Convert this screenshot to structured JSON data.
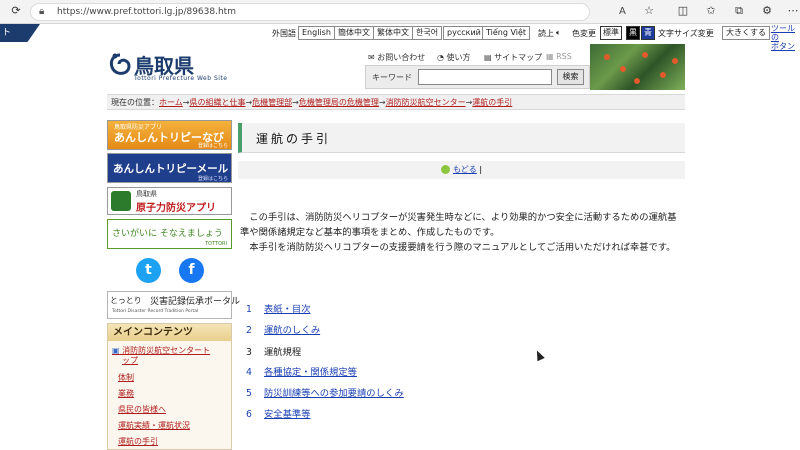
{
  "browser": {
    "url": "https://www.pref.tottori.lg.jp/89638.htm",
    "read_aloud_icon": "A",
    "favorite_icon": "☆",
    "toolbar_icons": [
      "split-screen-icon",
      "favorites-icon",
      "collections-icon",
      "extensions-icon",
      "more-icon"
    ]
  },
  "topbar": {
    "corner_tab": "ト",
    "language_label": "外国語",
    "languages": [
      "English",
      "簡体中文",
      "繁体中文",
      "한국어",
      "русский",
      "Tiếng Việt"
    ],
    "tail_text": "読上",
    "color_label": "色変更",
    "color_options": [
      "標準",
      "黒",
      "青"
    ],
    "font_size_label": "文字サイズ変更",
    "font_size_button": "大きくする",
    "tool_link_line1": "ツールの",
    "tool_link_line2": "ボタン"
  },
  "header": {
    "logo_title": "鳥取県",
    "logo_subtitle": "Tottori Prefecture Web Site",
    "util_links": [
      "お問い合わせ",
      "使い方",
      "サイトマップ",
      "RSS"
    ],
    "search_label": "キーワード",
    "search_value": "",
    "search_button": "検索"
  },
  "breadcrumb": {
    "current_label": "現在の位置：",
    "items": [
      "ホーム",
      "県の組織と仕事",
      "危機管理部",
      "危機管理局の危機管理",
      "消防防災航空センター",
      "運航の手引"
    ]
  },
  "sidebar": {
    "banners": {
      "app": {
        "top": "鳥取県防災アプリ",
        "main": "あんしんトリピーなび",
        "small": "登録はこちら"
      },
      "mail": {
        "main": "あんしんトリピーメール",
        "small": "登録はこちら"
      },
      "nuclear": {
        "top": "鳥取県",
        "main": "原子力防災アプリ"
      },
      "prepare": {
        "main": "さいがいに そなえましょう",
        "small": "TOTTORI"
      }
    },
    "social": {
      "twitter": "t",
      "facebook": "f"
    },
    "portal": {
      "left": "とっとり",
      "right": "災害記録伝承ポータル",
      "sub": "Tottori Disaster Record Tradition Portal"
    },
    "menu_title": "メインコンテンツ",
    "menu_top_line1": "消防防災航空センタート",
    "menu_top_line2": "ップ",
    "menu_items": [
      "体制",
      "業務",
      "県民の皆様へ",
      "運航実績・運航状況",
      "運航の手引"
    ]
  },
  "main": {
    "title": "運航の手引",
    "back_link": "もどる",
    "intro_line1": "この手引は、消防防災ヘリコプターが災害発生時などに、より効果的かつ安全に活動するための運航基準や関係諸規定など基本的事項をまとめ、作成したものです。",
    "intro_line2": "本手引を消防防災ヘリコプターの支援要請を行う際のマニュアルとしてご活用いただければ幸甚です。",
    "toc": [
      {
        "num": "1",
        "label": "表紙・目次",
        "link": true
      },
      {
        "num": "2",
        "label": "運航のしくみ",
        "link": true
      },
      {
        "num": "3",
        "label": "運航規程",
        "link": false
      },
      {
        "num": "4",
        "label": "各種協定・関係規定等",
        "link": true
      },
      {
        "num": "5",
        "label": "防災訓練等への参加要請のしくみ",
        "link": true
      },
      {
        "num": "6",
        "label": "安全基準等",
        "link": true
      }
    ]
  }
}
